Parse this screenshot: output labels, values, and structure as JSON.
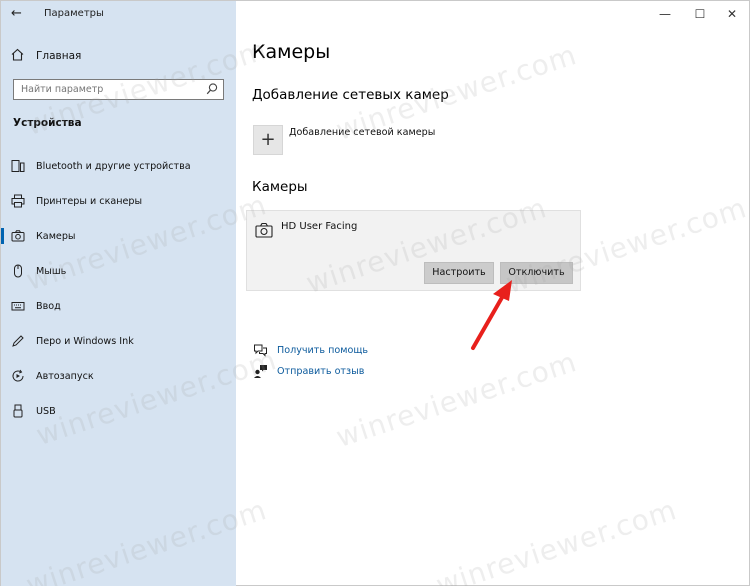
{
  "window": {
    "title": "Параметры",
    "back_icon": "back-arrow-icon",
    "minimize_glyph": "—",
    "maximize_glyph": "☐",
    "close_glyph": "✕"
  },
  "sidebar": {
    "home_label": "Главная",
    "search_placeholder": "Найти параметр",
    "section_title": "Устройства",
    "items": [
      {
        "label": "Bluetooth и другие устройства",
        "icon": "bluetooth-device-icon",
        "active": false
      },
      {
        "label": "Принтеры и сканеры",
        "icon": "printer-icon",
        "active": false
      },
      {
        "label": "Камеры",
        "icon": "camera-icon",
        "active": true
      },
      {
        "label": "Мышь",
        "icon": "mouse-icon",
        "active": false
      },
      {
        "label": "Ввод",
        "icon": "keyboard-icon",
        "active": false
      },
      {
        "label": "Перо и Windows Ink",
        "icon": "pen-icon",
        "active": false
      },
      {
        "label": "Автозапуск",
        "icon": "autoplay-icon",
        "active": false
      },
      {
        "label": "USB",
        "icon": "usb-icon",
        "active": false
      }
    ]
  },
  "main": {
    "title": "Камеры",
    "network_section_title": "Добавление сетевых камер",
    "add_network_camera_label": "Добавление сетевой камеры",
    "add_glyph": "+",
    "cameras_section_title": "Камеры",
    "camera": {
      "name": "HD User Facing",
      "configure_label": "Настроить",
      "disable_label": "Отключить"
    },
    "links": {
      "help_label": "Получить помощь",
      "feedback_label": "Отправить отзыв"
    }
  },
  "watermark_text": "winreviewer.com",
  "colors": {
    "sidebar_bg": "#d6e3f1",
    "accent": "#0063b1",
    "link": "#0b5a9c",
    "annotation_arrow": "#e8201c"
  }
}
